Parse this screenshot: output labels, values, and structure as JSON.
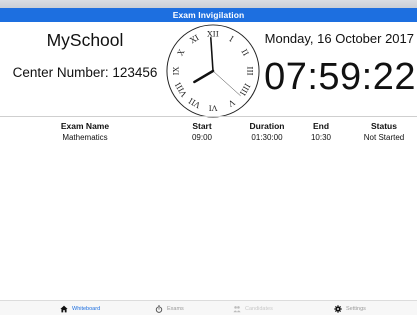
{
  "header": {
    "title": "Exam Invigilation"
  },
  "school": {
    "name": "MySchool",
    "center_number": "Center Number: 123456"
  },
  "clock": {
    "time": "07:59:22",
    "date": "Monday, 16 October 2017",
    "numerals": [
      "XII",
      "I",
      "II",
      "III",
      "IIII",
      "V",
      "VI",
      "VII",
      "VIII",
      "IX",
      "X",
      "XI"
    ]
  },
  "table": {
    "headers": {
      "name": "Exam Name",
      "start": "Start",
      "duration": "Duration",
      "end": "End",
      "status": "Status"
    },
    "rows": [
      {
        "name": "Mathematics",
        "start": "09:00",
        "duration": "01:30:00",
        "end": "10:30",
        "status": "Not Started"
      }
    ]
  },
  "tabs": [
    {
      "label": "Whiteboard",
      "icon": "home-icon"
    },
    {
      "label": "Exams",
      "icon": "stopwatch-icon"
    },
    {
      "label": "Candidates",
      "icon": "people-icon"
    },
    {
      "label": "Settings",
      "icon": "gear-icon"
    }
  ],
  "colors": {
    "accent": "#1d6fe0",
    "tab_active": "#1d6fe0",
    "tab_inactive": "#9a9a9a",
    "tab_disabled": "#c9c9c9"
  }
}
